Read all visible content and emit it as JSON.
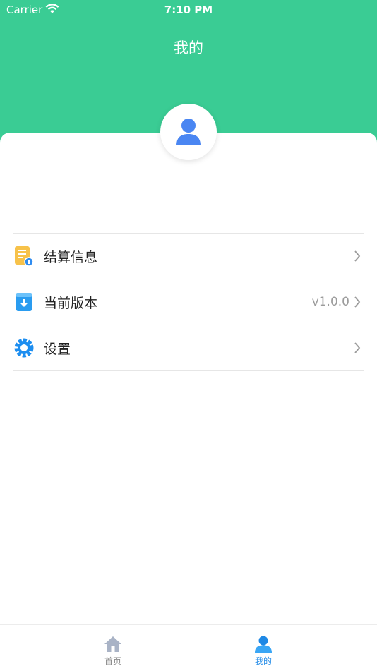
{
  "status_bar": {
    "carrier": "Carrier",
    "time": "7:10 PM"
  },
  "header": {
    "title": "我的",
    "color": "#3acc94"
  },
  "menu": {
    "items": [
      {
        "icon": "settlement-document-icon",
        "label": "结算信息",
        "value": ""
      },
      {
        "icon": "version-download-icon",
        "label": "当前版本",
        "value": "v1.0.0"
      },
      {
        "icon": "settings-gear-icon",
        "label": "设置",
        "value": ""
      }
    ]
  },
  "tabbar": {
    "tabs": [
      {
        "label": "首页",
        "icon": "home-icon",
        "active": false
      },
      {
        "label": "我的",
        "icon": "user-icon",
        "active": true
      }
    ],
    "active_color": "#2a8fe8"
  }
}
